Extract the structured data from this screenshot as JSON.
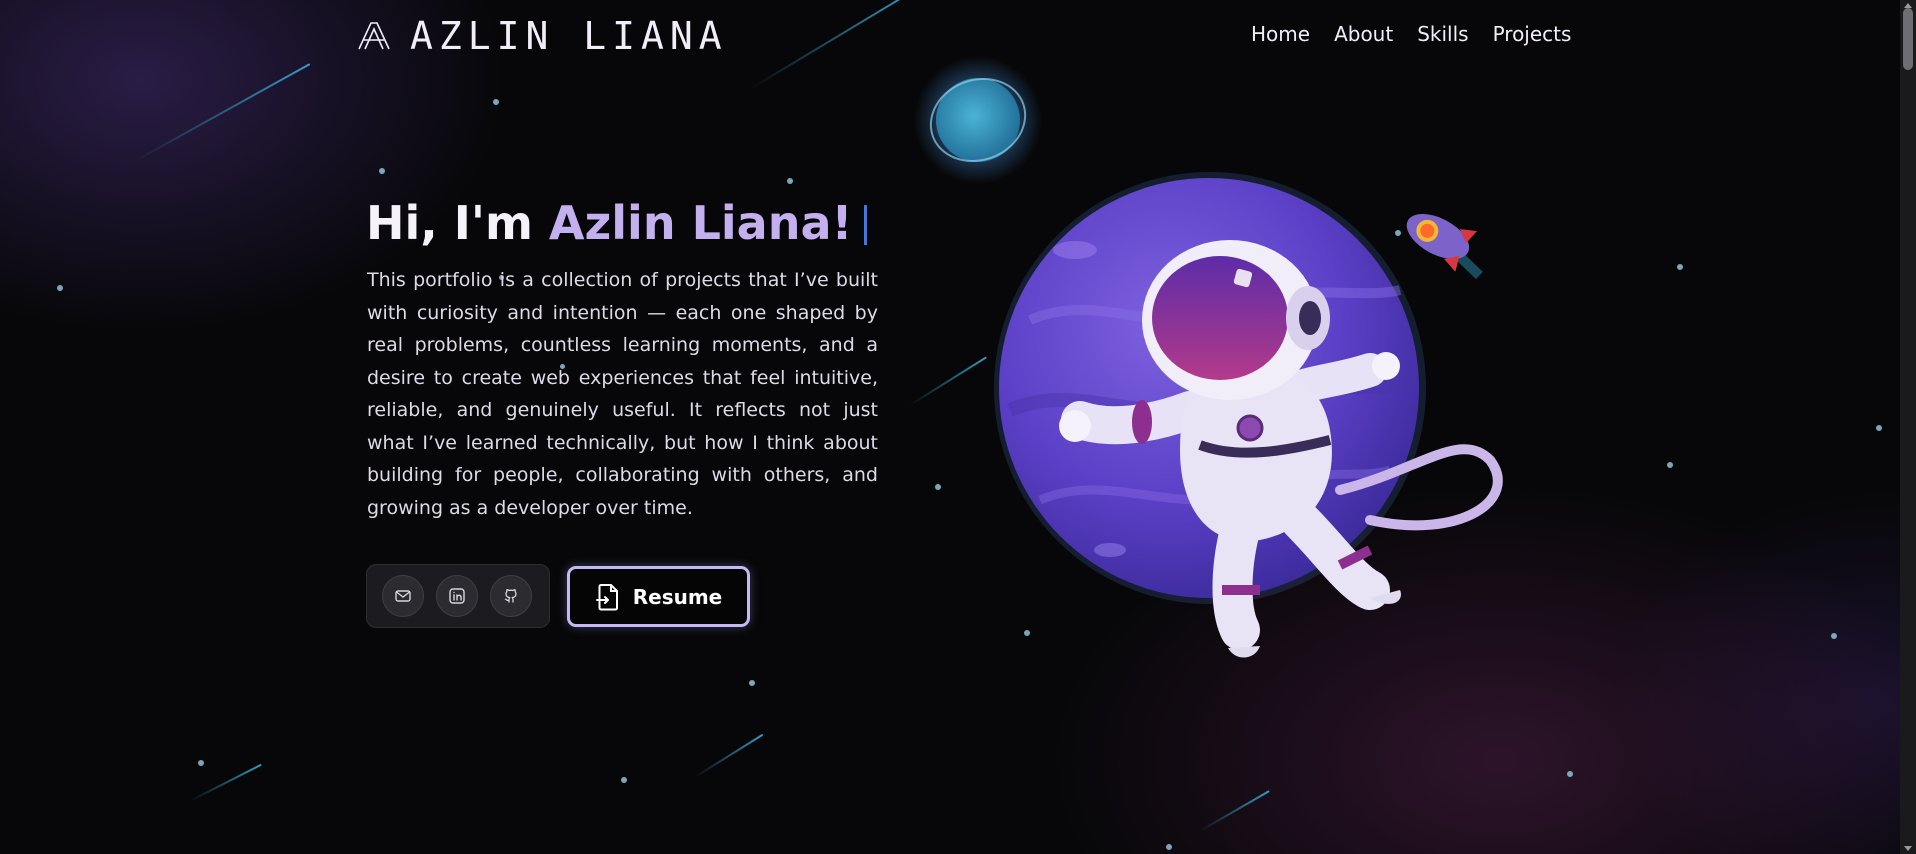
{
  "header": {
    "brand_name": "AZLIN LIANA",
    "logo_icon": "letter-a-logo-icon",
    "nav": [
      {
        "label": "Home"
      },
      {
        "label": "About"
      },
      {
        "label": "Skills"
      },
      {
        "label": "Projects"
      }
    ]
  },
  "hero": {
    "greeting": "Hi, I'm ",
    "name": "Azlin Liana!",
    "description": "This portfolio is a collection of projects that I’ve built with curiosity and intention — each one shaped by real problems, countless learning moments, and a desire to create web experiences that feel intuitive, reliable, and genuinely useful. It reflects not just what I’ve learned technically, but how I think about building for people, collaborating with others, and growing as a developer over time.",
    "social": [
      {
        "icon": "mail-icon"
      },
      {
        "icon": "linkedin-icon"
      },
      {
        "icon": "github-icon"
      }
    ],
    "resume_label": "Resume",
    "resume_icon": "document-arrow-icon"
  },
  "colors": {
    "background": "#070709",
    "accent": "#c4b0ee",
    "caret": "#4b74d8",
    "star": "#8fc2d6"
  }
}
